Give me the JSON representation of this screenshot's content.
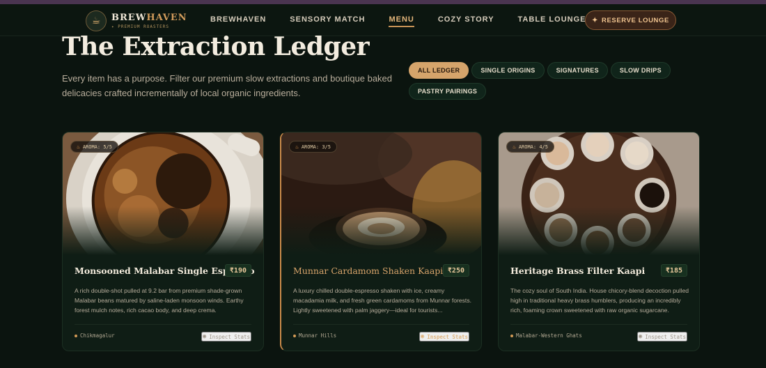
{
  "brand": {
    "icon": "coffee-cup-icon",
    "name_part1": "BREW",
    "name_part2": "HAVEN",
    "tagline": "✦ PREMIUM ROASTERS"
  },
  "nav": {
    "links": [
      "BREWHAVEN",
      "SENSORY MATCH",
      "MENU",
      "COZY STORY",
      "TABLE LOUNGE"
    ],
    "active": "MENU",
    "cta_icon": "sparkle-icon",
    "cta_label": "RESERVE LOUNGE"
  },
  "hero": {
    "title": "The Extraction Ledger",
    "subtitle": "Every item has a purpose. Filter our premium slow extractions and boutique baked delicacies crafted incrementally of local organic ingredients."
  },
  "filters": {
    "items": [
      "ALL LEDGER",
      "SINGLE ORIGINS",
      "SIGNATURES",
      "SLOW DRIPS",
      "PASTRY PAIRINGS"
    ],
    "active": "ALL LEDGER"
  },
  "cards": [
    {
      "aroma": "AROMA: 5/5",
      "title": "Monsooned Malabar Single Espresso",
      "price": "₹190",
      "description": "A rich double-shot pulled at 9.2 bar from premium shade-grown Malabar beans matured by saline-laden monsoon winds. Earthy forest mulch notes, rich cacao body, and deep crema.",
      "origin": "Chikmagalur",
      "action": "Inspect Stats"
    },
    {
      "aroma": "AROMA: 3/5",
      "title": "Munnar Cardamom Shaken Kaapi",
      "price": "₹250",
      "description": "A luxury chilled double-espresso shaken with ice, creamy macadamia milk, and fresh green cardamoms from Munnar forests. Lightly sweetened with palm jaggery—ideal for tourists...",
      "origin": "Munnar Hills",
      "action": "Inspect Stats"
    },
    {
      "aroma": "AROMA: 4/5",
      "title": "Heritage Brass Filter Kaapi",
      "price": "₹185",
      "description": "The cozy soul of South India. House chicory-blend decoction pulled high in traditional heavy brass humblers, producing an incredibly rich, foaming crown sweetened with raw organic sugarcane.",
      "origin": "Malabar-Western Ghats",
      "action": "Inspect Stats"
    }
  ],
  "colors": {
    "accent": "#d5a46b",
    "background": "#0b140f",
    "card": "#0f1d15"
  }
}
